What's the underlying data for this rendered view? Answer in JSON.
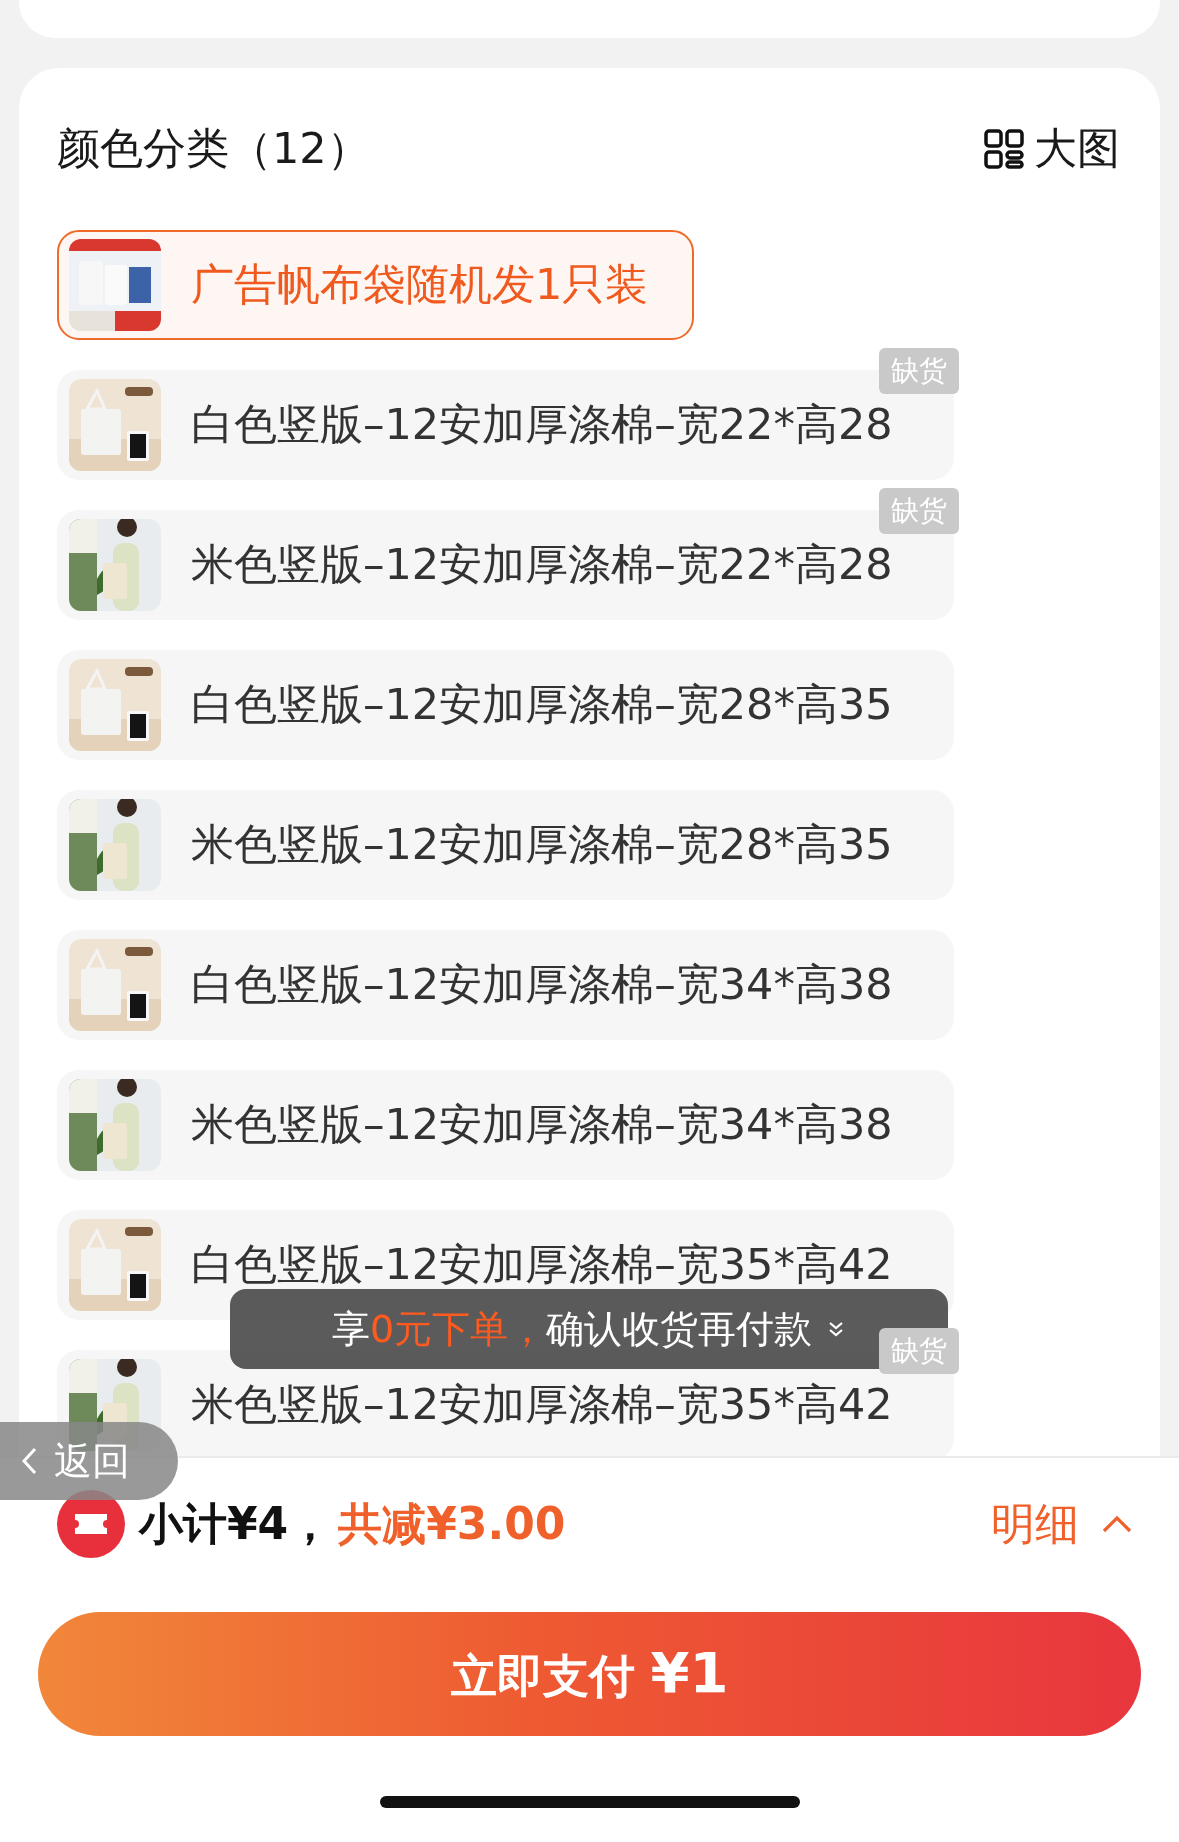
{
  "section": {
    "title": "颜色分类（12）",
    "view_toggle": "大图"
  },
  "options": [
    {
      "label": "广告帆布袋随机发1只装",
      "selected": true
    },
    {
      "label": "白色竖版–12安加厚涤棉–宽22*高28",
      "selected": false,
      "badge": "缺货"
    },
    {
      "label": "米色竖版–12安加厚涤棉–宽22*高28",
      "selected": false,
      "badge": "缺货"
    },
    {
      "label": "白色竖版–12安加厚涤棉–宽28*高35",
      "selected": false
    },
    {
      "label": "米色竖版–12安加厚涤棉–宽28*高35",
      "selected": false
    },
    {
      "label": "白色竖版–12安加厚涤棉–宽34*高38",
      "selected": false
    },
    {
      "label": "米色竖版–12安加厚涤棉–宽34*高38",
      "selected": false
    },
    {
      "label": "白色竖版–12安加厚涤棉–宽35*高42",
      "selected": false
    },
    {
      "label": "米色竖版–12安加厚涤棉–宽35*高42",
      "selected": false,
      "badge": "缺货"
    }
  ],
  "toast": {
    "prefix": "享",
    "highlight": "0元下单，",
    "suffix": "确认收货再付款"
  },
  "back_button": "返回",
  "summary": {
    "subtotal": "小计¥4，",
    "discount": "共减¥3.00",
    "details": "明细"
  },
  "pay_button": {
    "label": "立即支付",
    "price": "¥1"
  }
}
